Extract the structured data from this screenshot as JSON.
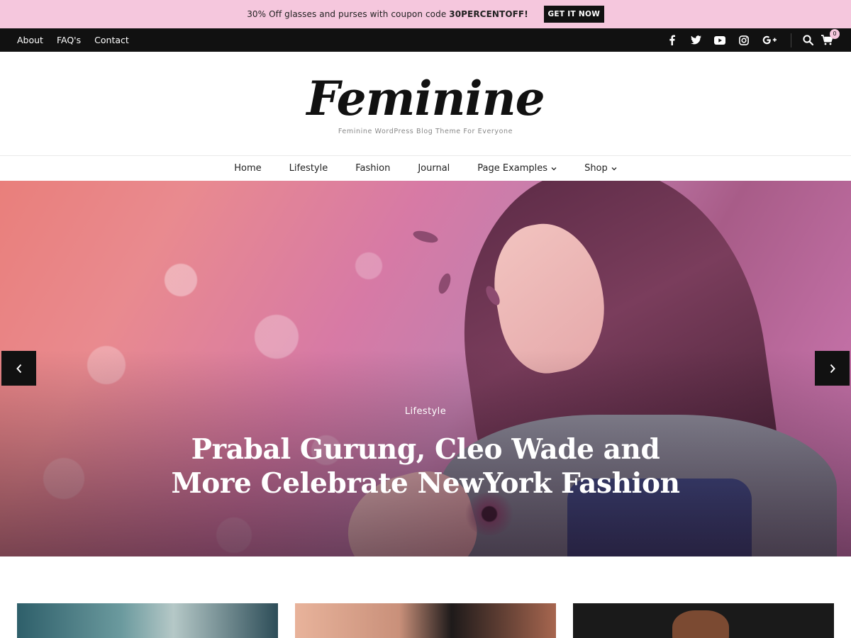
{
  "promo": {
    "text_prefix": "30% Off glasses and purses with coupon code ",
    "code": "30PERCENTOFF!",
    "button_label": "GET IT NOW"
  },
  "topbar": {
    "links": [
      "About",
      "FAQ's",
      "Contact"
    ],
    "social_icons": [
      "facebook-icon",
      "twitter-icon",
      "youtube-icon",
      "instagram-icon",
      "google-plus-icon"
    ],
    "cart_count": "0"
  },
  "header": {
    "logo": "Feminine",
    "tagline": "Feminine WordPress Blog Theme For Everyone"
  },
  "nav": {
    "items": [
      "Home",
      "Lifestyle",
      "Fashion",
      "Journal",
      "Page Examples",
      "Shop"
    ]
  },
  "hero": {
    "category": "Lifestyle",
    "title_line1": "Prabal Gurung, Cleo Wade and",
    "title_line2": "More Celebrate NewYork Fashion"
  },
  "colors": {
    "promo_bg": "#f5c7dd",
    "topbar_bg": "#111111",
    "accent": "#f5c7dd"
  }
}
